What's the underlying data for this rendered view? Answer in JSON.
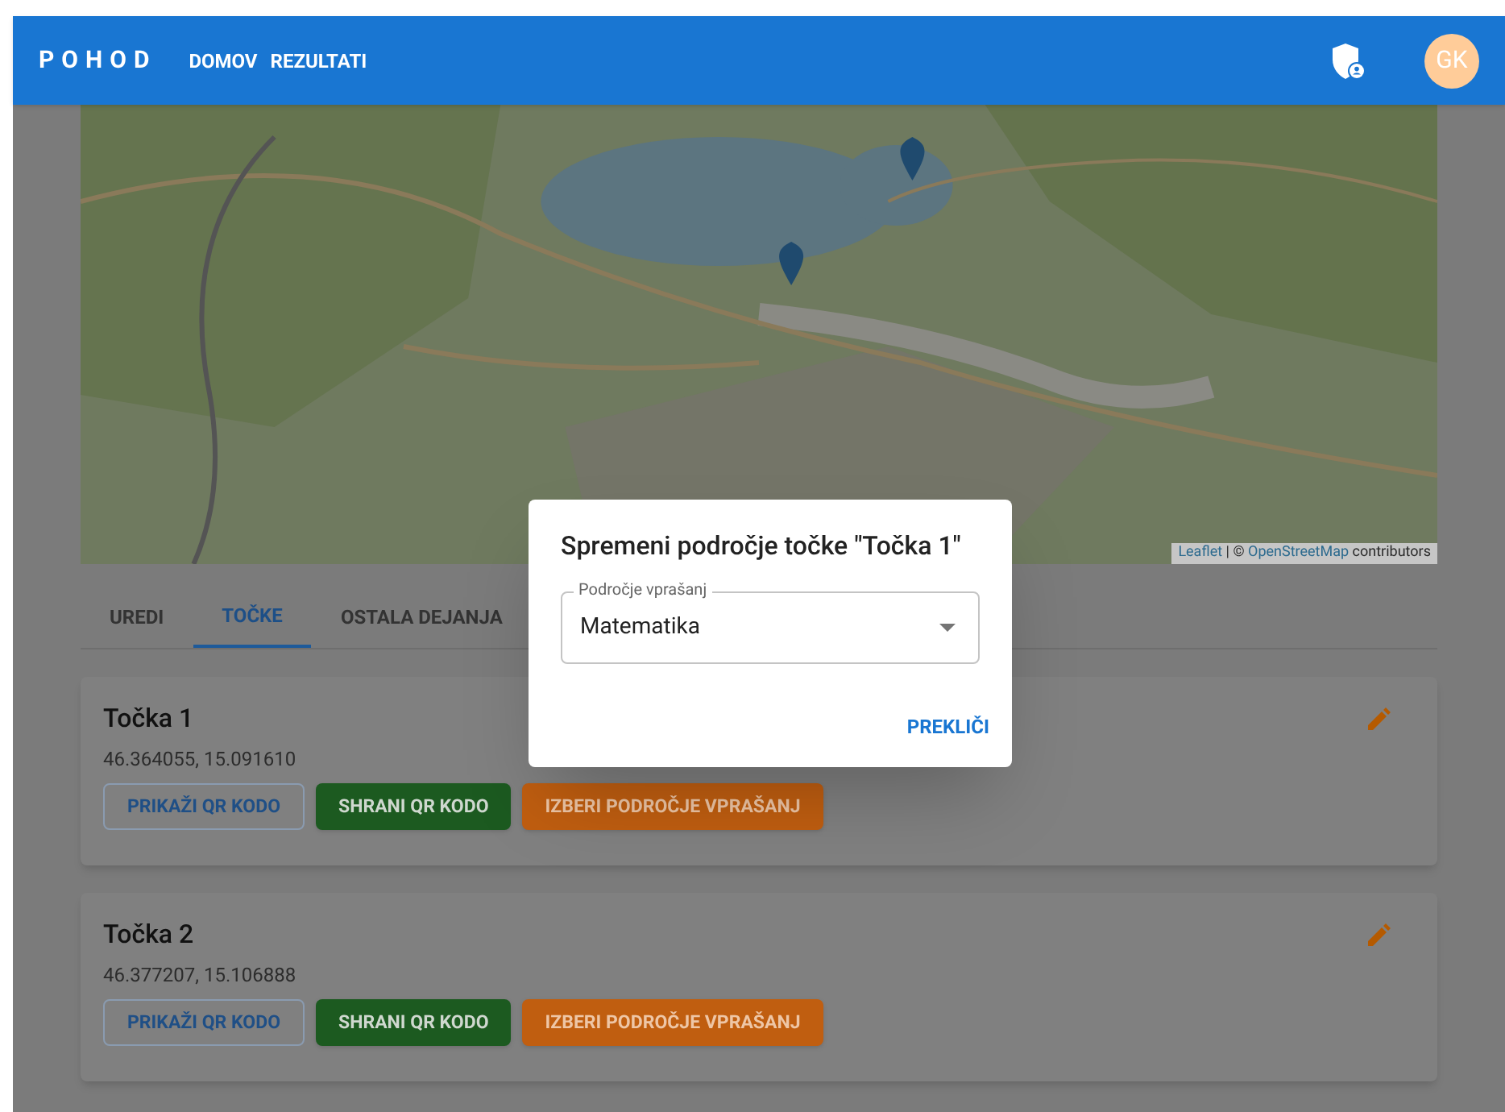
{
  "app_bar": {
    "brand": "POHOD",
    "nav": [
      {
        "label": "DOMOV"
      },
      {
        "label": "REZULTATI"
      }
    ],
    "avatar": "GK"
  },
  "map": {
    "attribution": {
      "link": "Leaflet",
      "separator": "| ©",
      "source": "OpenStreetMap",
      "suffix": "contributors"
    }
  },
  "tabs": [
    {
      "label": "UREDI",
      "selected": false
    },
    {
      "label": "TOČKE",
      "selected": true
    },
    {
      "label": "OSTALA DEJANJA",
      "selected": false
    }
  ],
  "points": [
    {
      "name": "Točka 1",
      "coords": "46.364055, 15.091610",
      "buttons": [
        {
          "label": "PRIKAŽI QR KODO",
          "kind": "outlined"
        },
        {
          "label": "SHRANI QR KODO",
          "kind": "success"
        },
        {
          "label": "IZBERI PODROČJE VPRAŠANJ",
          "kind": "warning"
        }
      ]
    },
    {
      "name": "Točka 2",
      "coords": "46.377207, 15.106888",
      "buttons": [
        {
          "label": "PRIKAŽI QR KODO",
          "kind": "outlined"
        },
        {
          "label": "SHRANI QR KODO",
          "kind": "success"
        },
        {
          "label": "IZBERI PODROČJE VPRAŠANJ",
          "kind": "warning"
        }
      ]
    }
  ],
  "dialog": {
    "title": "Spremeni področje točke \"Točka 1\"",
    "select": {
      "label": "Področje vprašanj",
      "value": "Matematika"
    },
    "actions": [
      "PREKLIČI"
    ]
  }
}
